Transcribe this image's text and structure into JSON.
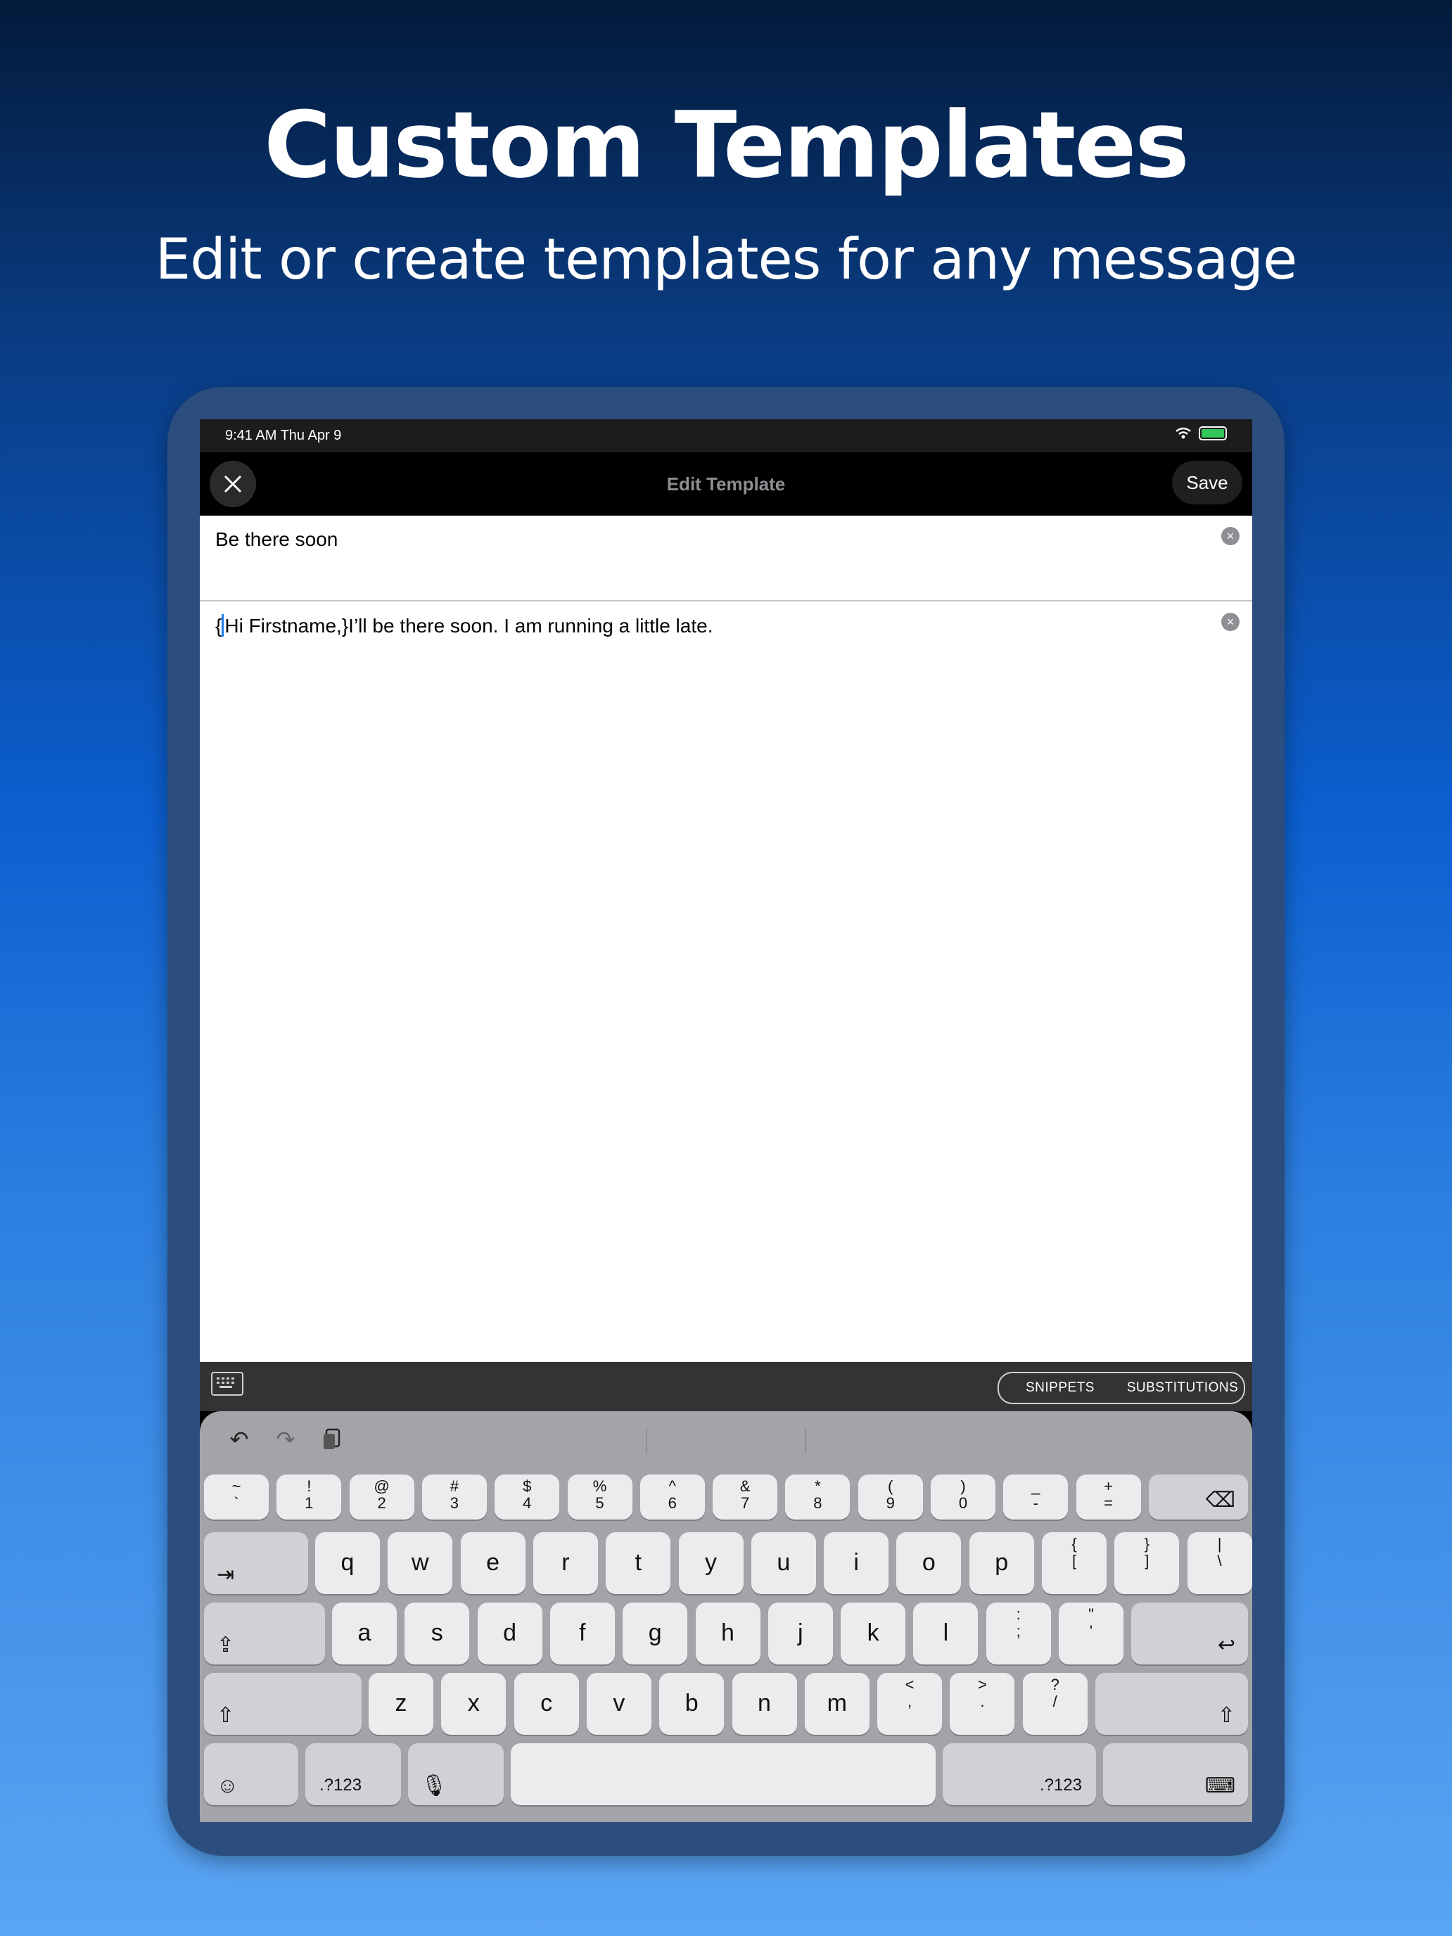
{
  "promo": {
    "headline": "Custom Templates",
    "subheadline": "Edit or create templates for any message"
  },
  "status_bar": {
    "time": "9:41 AM   Thu Apr 9"
  },
  "nav": {
    "title": "Edit Template",
    "save_label": "Save"
  },
  "editor": {
    "title_value": "Be there soon",
    "body_open_brace": "{",
    "body_rest": "Hi Firstname,}I’ll be there soon.  I am running a little late."
  },
  "accessory": {
    "segments": [
      "SNIPPETS",
      "SUBSTITUTIONS"
    ]
  },
  "keyboard": {
    "toolbar_icons": [
      "undo-icon",
      "redo-icon",
      "paste-icon"
    ],
    "number_row": [
      {
        "top": "~",
        "bottom": "`"
      },
      {
        "top": "!",
        "bottom": "1"
      },
      {
        "top": "@",
        "bottom": "2"
      },
      {
        "top": "#",
        "bottom": "3"
      },
      {
        "top": "$",
        "bottom": "4"
      },
      {
        "top": "%",
        "bottom": "5"
      },
      {
        "top": "^",
        "bottom": "6"
      },
      {
        "top": "&",
        "bottom": "7"
      },
      {
        "top": "*",
        "bottom": "8"
      },
      {
        "top": "(",
        "bottom": "9"
      },
      {
        "top": ")",
        "bottom": "0"
      },
      {
        "top": "_",
        "bottom": "-"
      },
      {
        "top": "+",
        "bottom": "="
      }
    ],
    "row1": [
      "q",
      "w",
      "e",
      "r",
      "t",
      "y",
      "u",
      "i",
      "o",
      "p"
    ],
    "row1_symbols": [
      {
        "top": "{",
        "bottom": "["
      },
      {
        "top": "}",
        "bottom": "]"
      },
      {
        "top": "|",
        "bottom": "\\"
      }
    ],
    "row2": [
      "a",
      "s",
      "d",
      "f",
      "g",
      "h",
      "j",
      "k",
      "l"
    ],
    "row2_symbols": [
      {
        "top": ":",
        "bottom": ";"
      },
      {
        "top": "\"",
        "bottom": "'"
      }
    ],
    "row3": [
      "z",
      "x",
      "c",
      "v",
      "b",
      "n",
      "m"
    ],
    "row3_symbols": [
      {
        "top": "<",
        "bottom": ","
      },
      {
        "top": ">",
        "bottom": "."
      },
      {
        "top": "?",
        "bottom": "/"
      }
    ],
    "numbers_label": ".?123",
    "numbers_label_right": ".?123"
  }
}
